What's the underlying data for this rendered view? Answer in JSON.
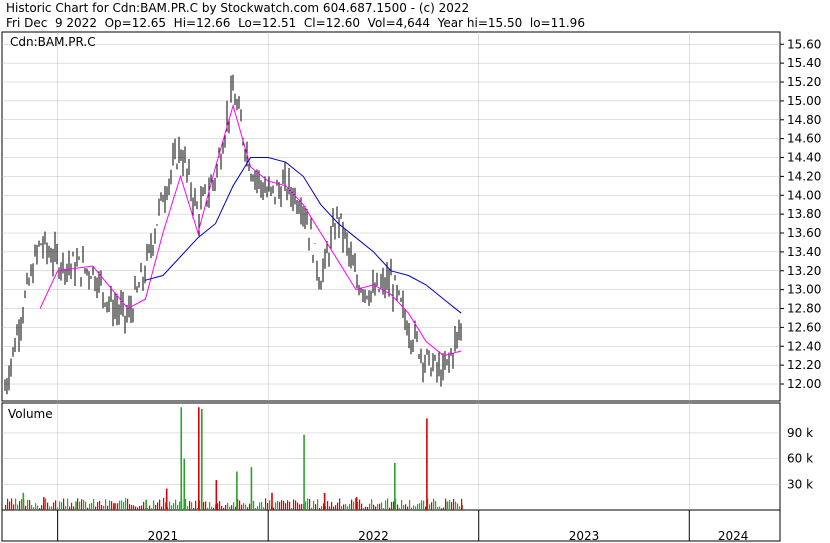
{
  "header": {
    "line1": "Historic Chart for Cdn:BAM.PR.C by Stockwatch.com 604.687.1500 - (c) 2022",
    "line2": "Fri Dec  9 2022  Op=12.65  Hi=12.66  Lo=12.51  Cl=12.60  Vol=4,644  Year hi=15.50  lo=11.96"
  },
  "price_panel": {
    "symbol_label": "Cdn:BAM.PR.C"
  },
  "volume_panel": {
    "label": "Volume"
  },
  "colors": {
    "price_bars": "#000000",
    "short_ma": "#ff00ff",
    "long_ma": "#0000cc",
    "volume_up": "#2ca02c",
    "volume_down": "#dd0000",
    "grid": "#c0c0c0",
    "frame": "#000000"
  },
  "chart_data": [
    {
      "type": "line",
      "title": "Cdn:BAM.PR.C",
      "description_of_marks": "daily OHLC bars with two moving averages",
      "x_axis": {
        "labels": [
          "2021",
          "2022",
          "2023",
          "2024"
        ],
        "range": [
          "2020-10",
          "2024-06"
        ]
      },
      "y_axis": {
        "ticks": [
          "15.60",
          "15.40",
          "15.20",
          "15.00",
          "14.80",
          "14.60",
          "14.40",
          "14.20",
          "14.00",
          "13.80",
          "13.60",
          "13.40",
          "13.20",
          "13.00",
          "12.80",
          "12.60",
          "12.40",
          "12.20",
          "12.00"
        ],
        "ylim": [
          11.82,
          15.73
        ]
      },
      "series": [
        {
          "values": [
            [
              "2020-10",
              11.95
            ],
            [
              "2020-11",
              12.8
            ],
            [
              "2020-12",
              13.5
            ],
            [
              "2021-01",
              13.3
            ],
            [
              "2021-02",
              13.25
            ],
            [
              "2021-03",
              13.2
            ],
            [
              "2021-04",
              12.85
            ],
            [
              "2021-05",
              12.7
            ],
            [
              "2021-06",
              13.2
            ],
            [
              "2021-07",
              14.0
            ],
            [
              "2021-08",
              14.5
            ],
            [
              "2021-09",
              13.8
            ],
            [
              "2021-10",
              14.2
            ],
            [
              "2021-11",
              15.1
            ],
            [
              "2021-12",
              14.3
            ],
            [
              "2022-01",
              14.0
            ],
            [
              "2022-02",
              14.1
            ],
            [
              "2022-03",
              13.9
            ],
            [
              "2022-04",
              13.1
            ],
            [
              "2022-05",
              13.8
            ],
            [
              "2022-06",
              13.1
            ],
            [
              "2022-07",
              12.95
            ],
            [
              "2022-08",
              13.1
            ],
            [
              "2022-09",
              12.6
            ],
            [
              "2022-10",
              12.25
            ],
            [
              "2022-11",
              12.1
            ],
            [
              "2022-12",
              12.6
            ]
          ]
        },
        {
          "values": [
            [
              "2020-12",
              12.8
            ],
            [
              "2021-01",
              13.2
            ],
            [
              "2021-03",
              13.25
            ],
            [
              "2021-05",
              12.8
            ],
            [
              "2021-06",
              12.9
            ],
            [
              "2021-07",
              13.6
            ],
            [
              "2021-08",
              14.2
            ],
            [
              "2021-09",
              13.6
            ],
            [
              "2021-10",
              14.3
            ],
            [
              "2021-11",
              14.95
            ],
            [
              "2021-12",
              14.3
            ],
            [
              "2022-01",
              14.15
            ],
            [
              "2022-02",
              14.1
            ],
            [
              "2022-03",
              13.9
            ],
            [
              "2022-04",
              13.6
            ],
            [
              "2022-05",
              13.3
            ],
            [
              "2022-06",
              13.0
            ],
            [
              "2022-07",
              13.05
            ],
            [
              "2022-08",
              12.95
            ],
            [
              "2022-09",
              12.75
            ],
            [
              "2022-10",
              12.45
            ],
            [
              "2022-11",
              12.3
            ],
            [
              "2022-12",
              12.35
            ]
          ]
        },
        {
          "values": [
            [
              "2021-06",
              13.1
            ],
            [
              "2021-07",
              13.15
            ],
            [
              "2021-08",
              13.35
            ],
            [
              "2021-09",
              13.55
            ],
            [
              "2021-10",
              13.7
            ],
            [
              "2021-11",
              14.1
            ],
            [
              "2021-12",
              14.4
            ],
            [
              "2022-01",
              14.4
            ],
            [
              "2022-02",
              14.35
            ],
            [
              "2022-03",
              14.2
            ],
            [
              "2022-04",
              13.9
            ],
            [
              "2022-05",
              13.7
            ],
            [
              "2022-06",
              13.55
            ],
            [
              "2022-07",
              13.4
            ],
            [
              "2022-08",
              13.2
            ],
            [
              "2022-09",
              13.15
            ],
            [
              "2022-10",
              13.05
            ],
            [
              "2022-11",
              12.9
            ],
            [
              "2022-12",
              12.75
            ]
          ]
        }
      ]
    },
    {
      "type": "bar",
      "title": "Volume",
      "y_axis": {
        "ticks": [
          "90 k",
          "60 k",
          "30 k"
        ],
        "ylim": [
          0,
          125
        ]
      },
      "values_in_thousands": [
        [
          "2020-11",
          20,
          "up"
        ],
        [
          "2020-12",
          15,
          "down"
        ],
        [
          "2021-02",
          10,
          "up"
        ],
        [
          "2021-04",
          8,
          "down"
        ],
        [
          "2021-06",
          12,
          "up"
        ],
        [
          "2021-07",
          25,
          "down"
        ],
        [
          "2021-08",
          120,
          "up"
        ],
        [
          "2021-08",
          60,
          "up"
        ],
        [
          "2021-09",
          120,
          "down"
        ],
        [
          "2021-09",
          118,
          "up"
        ],
        [
          "2021-10",
          35,
          "down"
        ],
        [
          "2021-11",
          45,
          "up"
        ],
        [
          "2021-12",
          50,
          "up"
        ],
        [
          "2022-01",
          20,
          "down"
        ],
        [
          "2022-03",
          88,
          "up"
        ],
        [
          "2022-04",
          20,
          "down"
        ],
        [
          "2022-06",
          15,
          "down"
        ],
        [
          "2022-08",
          55,
          "up"
        ],
        [
          "2022-10",
          107,
          "down"
        ],
        [
          "2022-11",
          10,
          "up"
        ],
        [
          "2022-12",
          6,
          "down"
        ]
      ]
    }
  ]
}
